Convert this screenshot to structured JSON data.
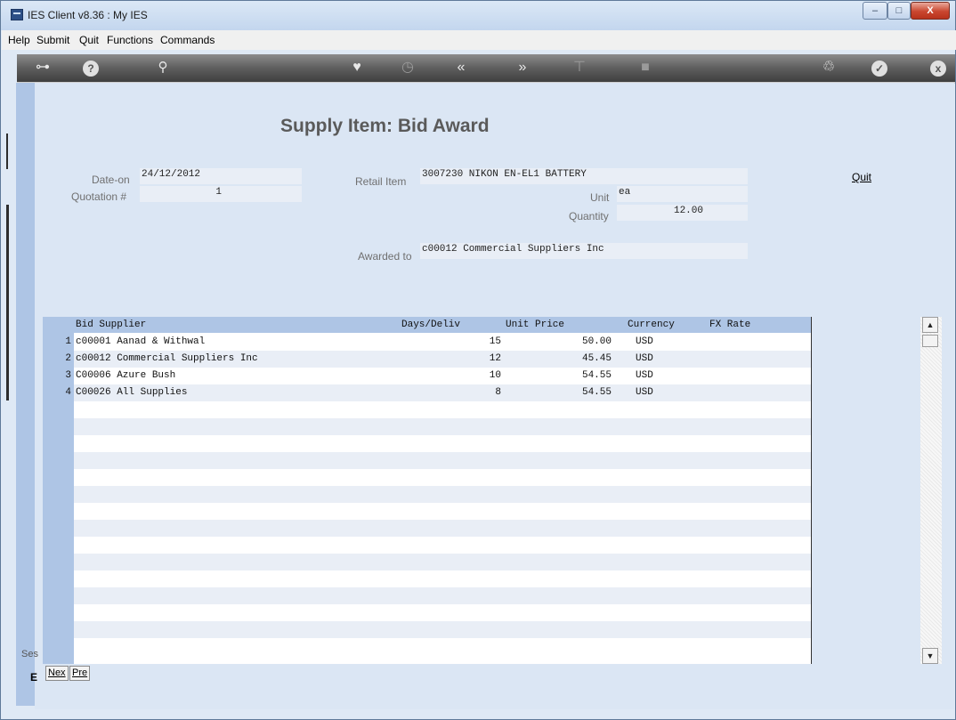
{
  "window": {
    "title": "IES Client v8.36 : My IES",
    "minimize": "–",
    "maximize": "□",
    "close": "X"
  },
  "menu": [
    "Help",
    "Submit",
    "Quit",
    "Functions",
    "Commands"
  ],
  "toolbar": {
    "icons": [
      "key-icon",
      "help-icon",
      "search-icon",
      "heart-icon",
      "clock-icon",
      "rewind-icon",
      "fastforward-icon",
      "fork-icon",
      "page-icon",
      "recycle-icon",
      "check-icon",
      "close-icon"
    ],
    "glyphs": [
      "⊶",
      "?",
      "🔍",
      "♥",
      "◷",
      "«",
      "»",
      "⊤",
      "■",
      "♲",
      "✓",
      "x"
    ]
  },
  "form": {
    "title": "Supply Item: Bid Award",
    "date_label": "Date-on",
    "date_value": "24/12/2012",
    "quotation_label": "Quotation #",
    "quotation_value": "1",
    "retail_label": "Retail Item",
    "retail_value": "3007230 NIKON EN-EL1 BATTERY",
    "unit_label": "Unit",
    "unit_value": "ea",
    "quantity_label": "Quantity",
    "quantity_value": "12.00",
    "awarded_label": "Awarded to",
    "awarded_value": "c00012 Commercial Suppliers Inc",
    "quit_label": "Quit"
  },
  "grid": {
    "headers": {
      "supplier": "Bid Supplier",
      "days": "Days/Deliv",
      "price": "Unit Price",
      "currency": "Currency",
      "fx": "FX Rate"
    },
    "rows": [
      {
        "num": "1",
        "supplier": "c00001 Aanad & Withwal",
        "days": "15",
        "price": "50.00",
        "currency": "USD"
      },
      {
        "num": "2",
        "supplier": "c00012 Commercial Suppliers Inc",
        "days": "12",
        "price": "45.45",
        "currency": "USD"
      },
      {
        "num": "3",
        "supplier": "C00006 Azure Bush",
        "days": "10",
        "price": "54.55",
        "currency": "USD"
      },
      {
        "num": "4",
        "supplier": "C00026 All Supplies",
        "days": "8",
        "price": "54.55",
        "currency": "USD"
      }
    ]
  },
  "footer": {
    "next_label": "Nex",
    "prev_label": "Pre",
    "session_label": "Ses",
    "status_char": "E"
  }
}
